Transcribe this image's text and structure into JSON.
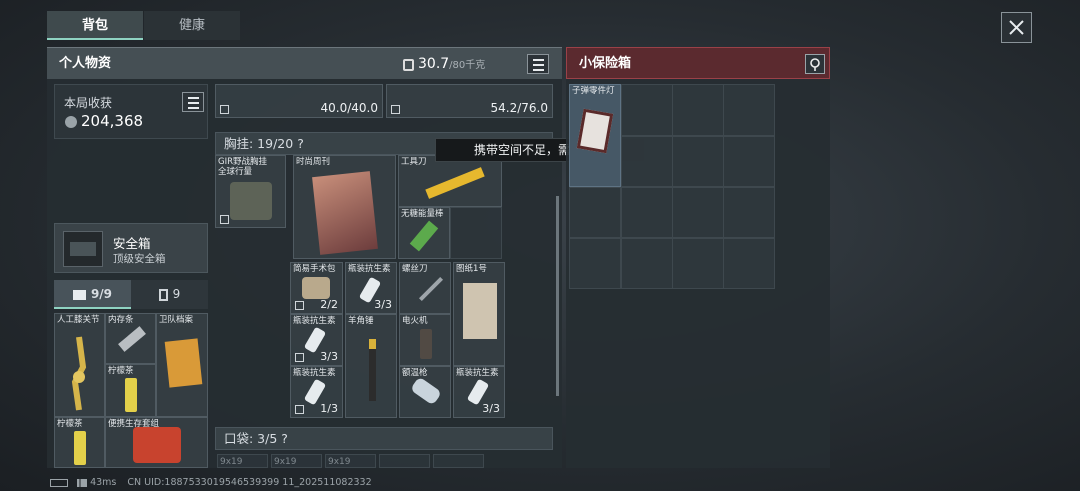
{
  "tabs": [
    "背包",
    "健康"
  ],
  "personal": {
    "title": "个人物资",
    "weight": "30.7",
    "capacity": "/80千克"
  },
  "safe_box": {
    "title": "小保险箱",
    "item_label": "子弹零件灯"
  },
  "earnings": {
    "label": "本局收获",
    "value": "204,368"
  },
  "secure_case": {
    "title": "安全箱",
    "subtitle": "顶级安全箱"
  },
  "case_tabs": {
    "slots": "9/9",
    "count": "9"
  },
  "left_items": [
    {
      "label": "人工膝关节"
    },
    {
      "label": "内存条"
    },
    {
      "label": "卫队档案"
    },
    {
      "label": "柠檬茶"
    },
    {
      "label": "柠檬茶"
    },
    {
      "label": "便携生存套组"
    }
  ],
  "top_weights": [
    "40.0/40.0",
    "54.2/76.0"
  ],
  "chest_rig": {
    "title": "胸挂: 19/20",
    "help": "?",
    "rig_name": "GIR野战胸挂 全球行量"
  },
  "tooltip": "携带空间不足，需要容量",
  "rig_items": [
    {
      "label": "时尚周刊"
    },
    {
      "label": "工具刀"
    },
    {
      "label": "无糖能量棒"
    },
    {
      "label": "简易手术包",
      "count": "2/2"
    },
    {
      "label": "瓶装抗生素",
      "count": "3/3"
    },
    {
      "label": "螺丝刀"
    },
    {
      "label": "图纸1号"
    },
    {
      "label": "瓶装抗生素",
      "count": "3/3"
    },
    {
      "label": "羊角锤"
    },
    {
      "label": "电火机"
    },
    {
      "label": "瓶装抗生素",
      "count": "1/3"
    },
    {
      "label": "额温枪"
    },
    {
      "label": "瓶装抗生素",
      "count": "3/3"
    }
  ],
  "pocket": {
    "title": "口袋: 3/5",
    "help": "?",
    "slots": [
      "9x19",
      "9x19",
      "9x19"
    ]
  },
  "status": {
    "ping": "43ms",
    "uid": "CN UID:1887533019546539399 11_202511082332"
  },
  "colors": {
    "accent": "#8fd3c2",
    "safe_header": "#6a2e33"
  }
}
